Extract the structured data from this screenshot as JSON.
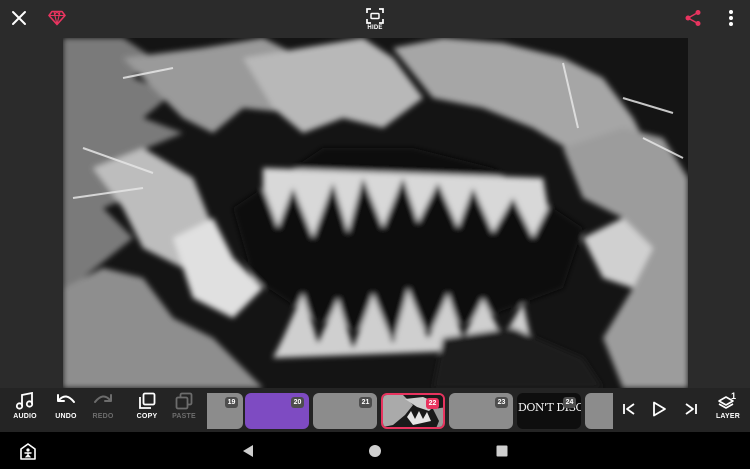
{
  "header": {
    "hide_label": "HIDE",
    "icons": [
      "close-icon",
      "premium-gem-icon",
      "hide-frame-icon",
      "share-icon",
      "more-vertical-icon"
    ],
    "accent_color": "#e8345f"
  },
  "toolbar": {
    "audio_label": "AUDIO",
    "undo_label": "UNDO",
    "redo_label": "REDO",
    "copy_label": "COPY",
    "paste_label": "PASTE",
    "layer_label": "LAYER",
    "layer_count": "1"
  },
  "timeline": {
    "frames": [
      {
        "number": "19",
        "style": "gray"
      },
      {
        "number": "20",
        "style": "purple"
      },
      {
        "number": "21",
        "style": "gray"
      },
      {
        "number": "22",
        "style": "selected"
      },
      {
        "number": "23",
        "style": "gray"
      },
      {
        "number": "24",
        "style": "dark",
        "text": "DON'T DISOBEY"
      }
    ],
    "selected_frame": "22",
    "purple_color": "#7e4bc2"
  },
  "system_nav": {
    "icons": [
      "accessibility-icon",
      "back-icon",
      "home-icon",
      "recents-icon"
    ]
  }
}
